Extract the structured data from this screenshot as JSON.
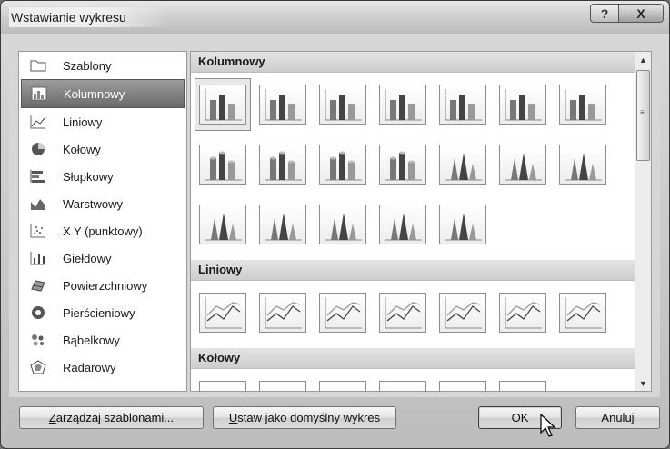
{
  "dialog": {
    "title": "Wstawianie wykresu",
    "help_glyph": "?",
    "close_glyph": "X"
  },
  "categories": [
    {
      "label": "Szablony",
      "icon": "folder-icon"
    },
    {
      "label": "Kolumnowy",
      "icon": "column-chart-icon",
      "selected": true
    },
    {
      "label": "Liniowy",
      "icon": "line-chart-icon"
    },
    {
      "label": "Kołowy",
      "icon": "pie-chart-icon"
    },
    {
      "label": "Słupkowy",
      "icon": "bar-chart-icon"
    },
    {
      "label": "Warstwowy",
      "icon": "area-chart-icon"
    },
    {
      "label": "X Y (punktowy)",
      "icon": "scatter-chart-icon"
    },
    {
      "label": "Giełdowy",
      "icon": "stock-chart-icon"
    },
    {
      "label": "Powierzchniowy",
      "icon": "surface-chart-icon"
    },
    {
      "label": "Pierścieniowy",
      "icon": "doughnut-chart-icon"
    },
    {
      "label": "Bąbelkowy",
      "icon": "bubble-chart-icon"
    },
    {
      "label": "Radarowy",
      "icon": "radar-chart-icon"
    }
  ],
  "gallery": {
    "sections": [
      {
        "title": "Kolumnowy",
        "thumbs": [
          "clustered-column-icon",
          "stacked-column-icon",
          "100-stacked-column-icon",
          "3d-clustered-column-icon",
          "3d-stacked-column-icon",
          "3d-100-stacked-column-icon",
          "3d-column-icon",
          "clustered-cylinder-icon",
          "stacked-cylinder-icon",
          "100-stacked-cylinder-icon",
          "3d-cylinder-icon",
          "clustered-cone-icon",
          "stacked-cone-icon",
          "100-stacked-cone-icon",
          "3d-cone-icon",
          "clustered-pyramid-icon",
          "stacked-pyramid-icon",
          "100-stacked-pyramid-icon",
          "3d-pyramid-icon"
        ]
      },
      {
        "title": "Liniowy",
        "thumbs": [
          "line-icon",
          "stacked-line-icon",
          "100-stacked-line-icon",
          "line-with-markers-icon",
          "stacked-line-with-markers-icon",
          "100-stacked-line-with-markers-icon",
          "3d-line-icon"
        ]
      },
      {
        "title": "Kołowy",
        "thumbs": [
          "pie-icon",
          "3d-pie-icon",
          "pie-of-pie-icon",
          "exploded-pie-icon",
          "3d-exploded-pie-icon",
          "bar-of-pie-icon"
        ]
      }
    ]
  },
  "buttons": {
    "manage_templates": {
      "underline": "Z",
      "rest": "arządzaj szablonami..."
    },
    "set_default": {
      "underline": "U",
      "rest": "staw jako domyślny wykres"
    },
    "ok": "OK",
    "cancel": "Anuluj"
  }
}
